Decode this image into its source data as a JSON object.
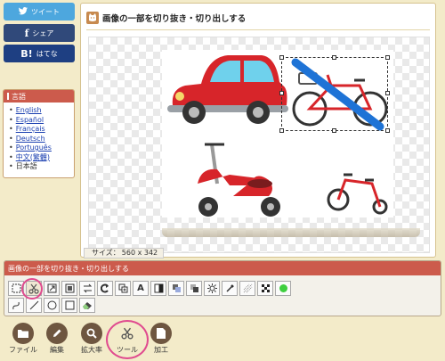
{
  "share": {
    "tweet": "ツイート",
    "share": "シェア",
    "hatena": "はてな"
  },
  "languages": {
    "header": "言語",
    "items": [
      {
        "label": "English",
        "link": true
      },
      {
        "label": "Español",
        "link": true
      },
      {
        "label": "Français",
        "link": true
      },
      {
        "label": "Deutsch",
        "link": true
      },
      {
        "label": "Português",
        "link": true
      },
      {
        "label": "中文(繁體)",
        "link": true
      },
      {
        "label": "日本語",
        "link": false
      }
    ]
  },
  "main": {
    "title": "画像の一部を切り抜き・切り出しする",
    "size_label": "サイズ：",
    "size_value": "560 x 342"
  },
  "palette": {
    "title": "画像の一部を切り抜き・切り出しする",
    "row1": [
      "select-rect-icon",
      "scissors-icon",
      "resize-icon",
      "crop-icon",
      "swap-icon",
      "rotate-icon",
      "copy-icon",
      "text-icon",
      "contrast-icon",
      "layers-icon",
      "blur-icon",
      "brightness-icon",
      "eyedropper-icon",
      "noise-icon",
      "mosaic-icon",
      "green-dot-icon"
    ],
    "row2": [
      "freehand-icon",
      "line-icon",
      "circle-icon",
      "rectangle-icon",
      "eraser-icon"
    ]
  },
  "bottom": {
    "file": "ファイル",
    "edit": "編集",
    "zoom": "拡大率",
    "tool": "ツール",
    "process": "加工"
  },
  "colors": {
    "accent": "#cc5b4c",
    "highlight": "#e04b8f",
    "brown": "#6e5640"
  }
}
